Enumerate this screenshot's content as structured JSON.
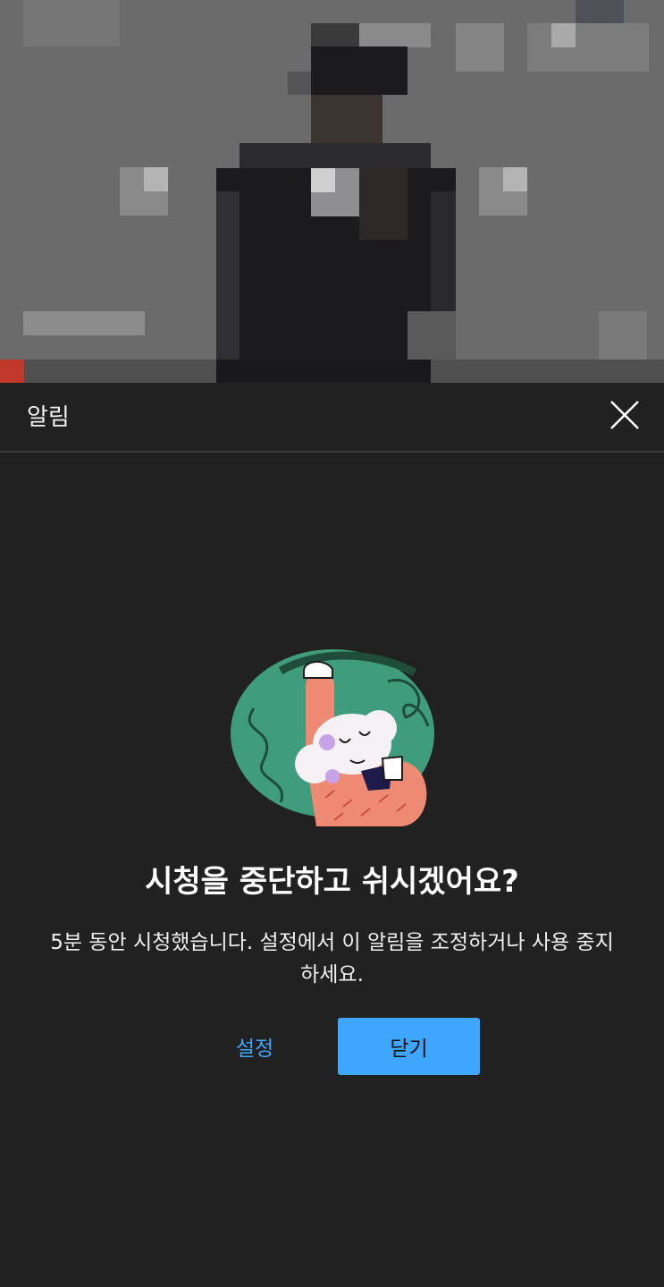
{
  "video": {
    "progress_fraction": 0.037,
    "progress_color": "#c0392b"
  },
  "sheet": {
    "title": "알림",
    "close_icon": "close-icon"
  },
  "reminder": {
    "illustration": "person-resting-illustration",
    "headline": "시청을 중단하고 쉬시겠어요?",
    "message": "5분 동안 시청했습니다. 설정에서 이 알림을 조정하거나 사용 중지하세요.",
    "settings_label": "설정",
    "close_label": "닫기"
  },
  "colors": {
    "accent": "#3ea6ff",
    "background": "#212121"
  }
}
